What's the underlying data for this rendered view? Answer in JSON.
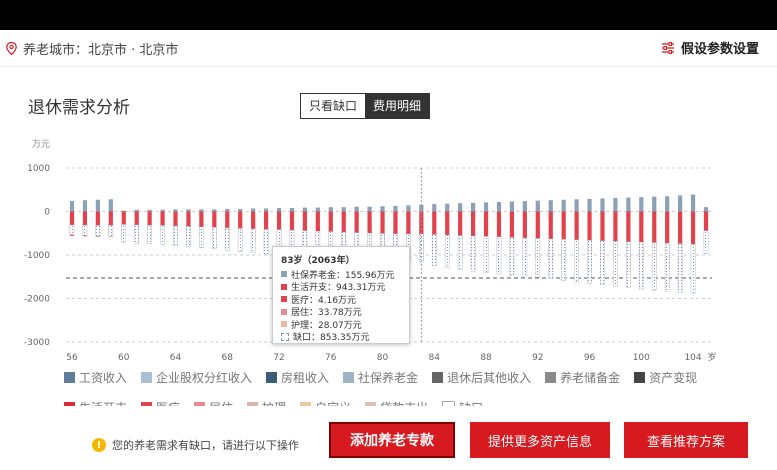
{
  "location": {
    "label": "养老城市：北京市 · 北京市"
  },
  "settings": {
    "label": "假设参数设置"
  },
  "panel": {
    "title": "退休需求分析"
  },
  "toggle": {
    "gap_only": "只看缺口",
    "detail": "费用明细"
  },
  "chart_data": {
    "type": "bar",
    "y_unit": "万元",
    "ylim": [
      -3000,
      1000
    ],
    "yticks": [
      1000,
      0,
      -1000,
      -2000,
      -3000
    ],
    "x_unit": "岁",
    "xticks": [
      56,
      60,
      64,
      68,
      72,
      76,
      80,
      84,
      88,
      92,
      96,
      100,
      104
    ],
    "ages": [
      56,
      57,
      58,
      59,
      60,
      61,
      62,
      63,
      64,
      65,
      66,
      67,
      68,
      69,
      70,
      71,
      72,
      73,
      74,
      75,
      76,
      77,
      78,
      79,
      80,
      81,
      82,
      83,
      84,
      85,
      86,
      87,
      88,
      89,
      90,
      91,
      92,
      93,
      94,
      95,
      96,
      97,
      98,
      99,
      100,
      101,
      102,
      103,
      104,
      105
    ],
    "series": [
      {
        "name": "社保养老金",
        "color": "#8aa1b8",
        "values": [
          240,
          260,
          270,
          280,
          20,
          40,
          40,
          40,
          50,
          50,
          50,
          50,
          60,
          60,
          70,
          70,
          80,
          80,
          90,
          90,
          100,
          100,
          110,
          110,
          120,
          130,
          140,
          156,
          170,
          180,
          190,
          200,
          210,
          220,
          230,
          240,
          250,
          260,
          270,
          280,
          290,
          300,
          310,
          320,
          330,
          340,
          350,
          370,
          390,
          100
        ]
      },
      {
        "name": "生活开支",
        "color": "#e2424c",
        "values": [
          -560,
          -570,
          -580,
          -580,
          -540,
          -560,
          -570,
          -580,
          -600,
          -620,
          -640,
          -660,
          -680,
          -700,
          -720,
          -740,
          -760,
          -780,
          -800,
          -820,
          -840,
          -860,
          -880,
          -900,
          -920,
          -930,
          -940,
          -943,
          -960,
          -980,
          -1000,
          -1020,
          -1040,
          -1060,
          -1080,
          -1100,
          -1120,
          -1140,
          -1160,
          -1180,
          -1200,
          -1220,
          -1240,
          -1260,
          -1280,
          -1300,
          -1320,
          -1340,
          -1360,
          -800
        ]
      },
      {
        "name": "缺口",
        "color": "#5b7fb0",
        "values": [
          -300,
          -320,
          -330,
          -340,
          -540,
          -560,
          -570,
          -580,
          -600,
          -620,
          -640,
          -660,
          -690,
          -720,
          -740,
          -760,
          -790,
          -810,
          -830,
          -850,
          -860,
          -860,
          -850,
          -850,
          -860,
          -860,
          -855,
          -853,
          -960,
          -1010,
          -1040,
          -1080,
          -1100,
          -1140,
          -1160,
          -1180,
          -1200,
          -1220,
          -1260,
          -1290,
          -1320,
          -1350,
          -1380,
          -1400,
          -1440,
          -1460,
          -1480,
          -1500,
          -1520,
          -700
        ]
      }
    ],
    "reference_line": -1530,
    "highlight_age": 83
  },
  "tooltip": {
    "title": "83岁（2063年）",
    "rows": [
      {
        "label": "社保养老金：155.96万元",
        "color": "#8aa1b8"
      },
      {
        "label": "生活开支：943.31万元",
        "color": "#e2424c"
      },
      {
        "label": "医疗：4.16万元",
        "color": "#e2424c"
      },
      {
        "label": "居住：33.78万元",
        "color": "#e88a90"
      },
      {
        "label": "护理：28.07万元",
        "color": "#e8b8a0"
      },
      {
        "label": "缺口：853.35万元",
        "color": "#ffffff"
      }
    ]
  },
  "legend_row1": [
    {
      "label": "工资收入",
      "color": "#5f7d9a"
    },
    {
      "label": "企业股权分红收入",
      "color": "#a8bfd4"
    },
    {
      "label": "房租收入",
      "color": "#3e5c7a"
    },
    {
      "label": "社保养老金",
      "color": "#9fb3c6"
    },
    {
      "label": "退休后其他收入",
      "color": "#666666"
    },
    {
      "label": "养老储备金",
      "color": "#8a8a8a"
    },
    {
      "label": "资产变现",
      "color": "#444444"
    }
  ],
  "legend_row2": [
    {
      "label": "生活开支",
      "color": "#d92b36"
    },
    {
      "label": "医疗",
      "color": "#e2424c"
    },
    {
      "label": "居住",
      "color": "#e88a90"
    },
    {
      "label": "护理",
      "color": "#d8b8a8"
    },
    {
      "label": "自定义",
      "color": "#e8c8a0"
    },
    {
      "label": "贷款支出",
      "color": "#e0c0b0"
    },
    {
      "label": "缺口",
      "color": "#ffffff"
    }
  ],
  "footer": {
    "warning": "您的养老需求有缺口，请进行以下操作",
    "btn_add": "添加养老专款",
    "btn_more": "提供更多资产信息",
    "btn_plan": "查看推荐方案"
  }
}
